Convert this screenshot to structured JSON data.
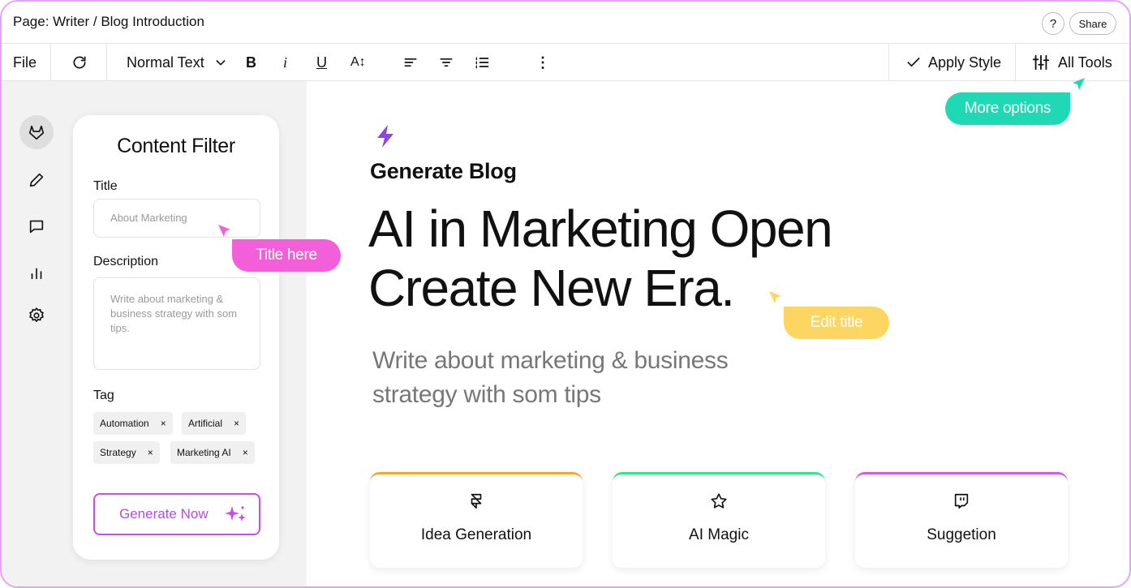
{
  "window": {
    "page_title": "Page: Writer / Blog Introduction",
    "help_label": "?",
    "share_label": "Share"
  },
  "toolbar": {
    "file_label": "File",
    "text_style": "Normal Text",
    "bold_label": "B",
    "italic_label": "i",
    "underline_label": "U",
    "fontsize_label": "A↕",
    "more_label": "⋮",
    "apply_style_label": "Apply Style",
    "all_tools_label": "All Tools"
  },
  "sidebar": {
    "icons": [
      "gitlab-icon",
      "pencil-icon",
      "chat-icon",
      "chart-icon",
      "settings-icon"
    ]
  },
  "filter": {
    "title": "Content Filter",
    "title_label": "Title",
    "title_placeholder": "About Marketing",
    "description_label": "Description",
    "description_placeholder": "Write about marketing & business strategy with som tips.",
    "tag_label": "Tag",
    "tags": [
      "Automation",
      "Artificial",
      "Strategy",
      "Marketing AI"
    ],
    "tag_remove": "×",
    "generate_label": "Generate Now"
  },
  "annotations": {
    "title_here": "Title here",
    "edit_title": "Edit title",
    "more_options": "More options"
  },
  "main": {
    "section_label": "Generate Blog",
    "headline_line1": "AI in Marketing Open",
    "headline_line2": "Create New Era.",
    "subtitle": "Write about marketing & business strategy with som tips",
    "cards": [
      {
        "label": "Idea Generation",
        "icon": "framer-icon",
        "accent": "#f2a733"
      },
      {
        "label": "AI Magic",
        "icon": "star-icon",
        "accent": "#3de08a"
      },
      {
        "label": "Suggetion",
        "icon": "twitch-icon",
        "accent": "#d35ae8"
      }
    ]
  },
  "colors": {
    "pink": "#f25fd8",
    "yellow": "#fcd661",
    "teal": "#1fd9b4",
    "purple": "#8e44e8"
  }
}
